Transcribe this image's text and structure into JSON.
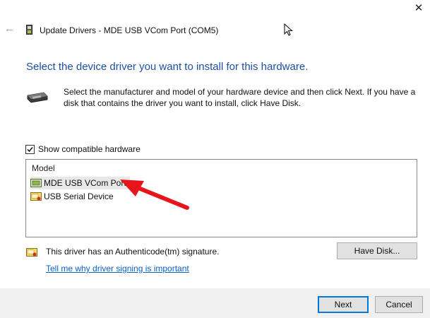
{
  "window": {
    "title": "Update Drivers - MDE USB VCom Port (COM5)",
    "close_glyph": "✕",
    "back_glyph": "←"
  },
  "main": {
    "heading": "Select the device driver you want to install for this hardware.",
    "description": "Select the manufacturer and model of your hardware device and then click Next. If you have a disk that contains the driver you want to install, click Have Disk.",
    "show_compatible_label": "Show compatible hardware",
    "show_compatible_checked": true,
    "model_header": "Model",
    "models": [
      {
        "label": "MDE USB VCom Port",
        "selected": true,
        "icon": "port-icon"
      },
      {
        "label": "USB Serial Device",
        "selected": false,
        "icon": "certified-driver-icon"
      }
    ],
    "signature_text": "This driver has an Authenticode(tm) signature.",
    "signature_link": "Tell me why driver signing is important",
    "have_disk_label": "Have Disk..."
  },
  "footer": {
    "next_label": "Next",
    "cancel_label": "Cancel"
  },
  "colors": {
    "heading": "#1f4fa3",
    "link": "#0a5fc4",
    "annotation_arrow": "#e8141c",
    "default_button_border": "#0078d7"
  }
}
